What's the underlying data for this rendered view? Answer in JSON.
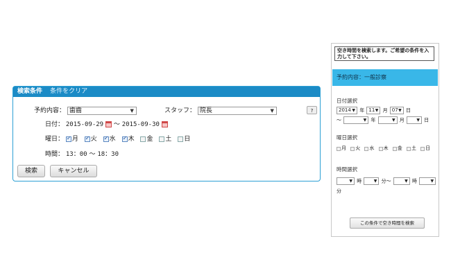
{
  "search_panel": {
    "title": "検索条件",
    "clear_label": "条件をクリア",
    "reservation_label": "予約内容：",
    "reservation_value": "歯齒",
    "staff_label": "スタッフ：",
    "staff_value": "院長",
    "help_label": "?",
    "date_label": "日付：",
    "date_from": "2015-09-29",
    "tilde": "〜",
    "date_to": "2015-09-30",
    "weekday_label": "曜日：",
    "weekdays": [
      {
        "label": "月",
        "checked": true
      },
      {
        "label": "火",
        "checked": true
      },
      {
        "label": "水",
        "checked": true
      },
      {
        "label": "木",
        "checked": true
      },
      {
        "label": "金",
        "checked": false
      },
      {
        "label": "土",
        "checked": false
      },
      {
        "label": "日",
        "checked": false
      }
    ],
    "time_label": "時間：",
    "time_from": "13：00",
    "time_to": "18：30",
    "search_button": "検索",
    "cancel_button": "キャンセル"
  },
  "mobile_panel": {
    "notice": "空き時間を検索します。ご希望の条件を入力して下さい。",
    "reservation_title": "予約内容：一般診察",
    "date_select_label": "日付選択",
    "year_value": "2014",
    "year_unit": "年",
    "month_value": "11",
    "month_unit": "月",
    "day_value": "07",
    "day_unit": "日",
    "tilde": "〜",
    "weekday_select_label": "曜日選択",
    "weekdays": [
      "月",
      "火",
      "水",
      "木",
      "金",
      "土",
      "日"
    ],
    "time_select_label": "時間選択",
    "hour_unit": "時",
    "minute_unit": "分",
    "search_button": "この条件で空き時間を検索"
  },
  "colors": {
    "header_blue": "#1b8bc6",
    "panel_border": "#2b9fd4",
    "mobile_bar": "#39b7e8"
  }
}
